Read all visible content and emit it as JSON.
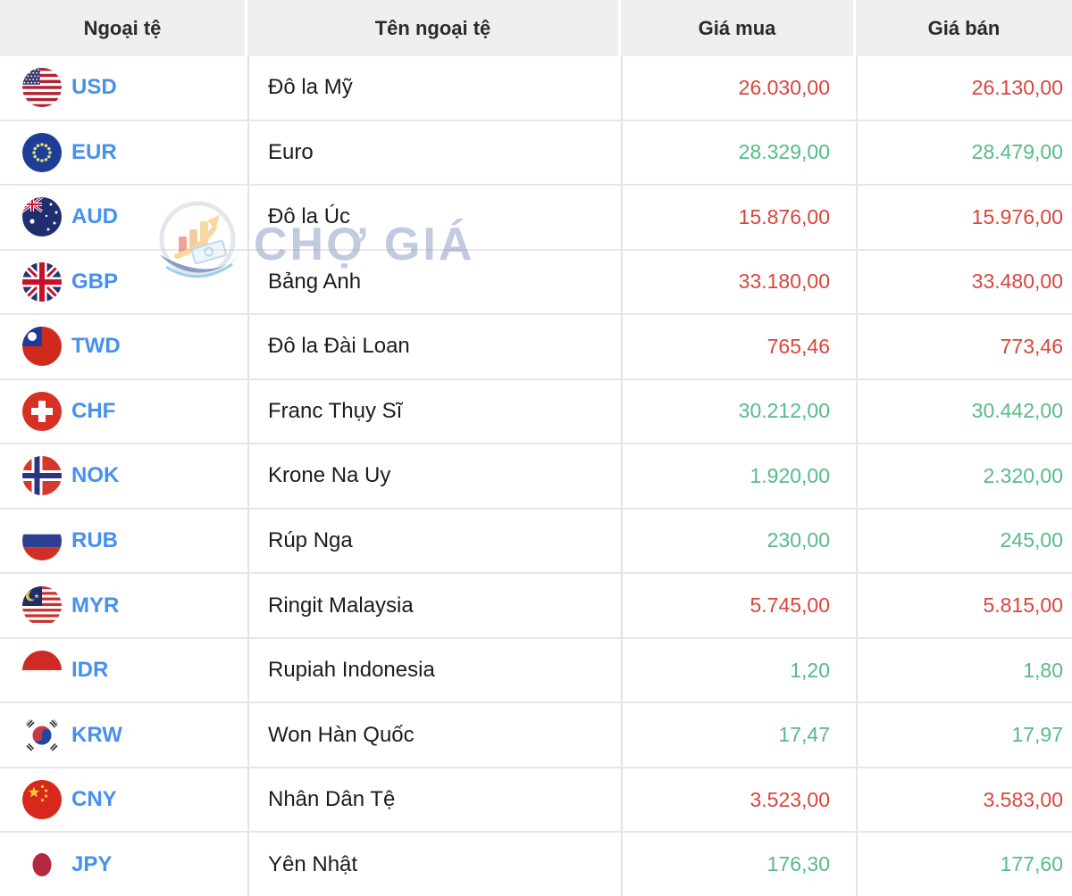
{
  "table": {
    "columns": [
      "Ngoại tệ",
      "Tên ngoại tệ",
      "Giá mua",
      "Giá bán"
    ],
    "rows": [
      {
        "code": "USD",
        "name": "Đô la Mỹ",
        "buy": "26.030,00",
        "sell": "26.130,00",
        "direction": "down"
      },
      {
        "code": "EUR",
        "name": "Euro",
        "buy": "28.329,00",
        "sell": "28.479,00",
        "direction": "up"
      },
      {
        "code": "AUD",
        "name": "Đô la Úc",
        "buy": "15.876,00",
        "sell": "15.976,00",
        "direction": "down"
      },
      {
        "code": "GBP",
        "name": "Bảng Anh",
        "buy": "33.180,00",
        "sell": "33.480,00",
        "direction": "down"
      },
      {
        "code": "TWD",
        "name": "Đô la Đài Loan",
        "buy": "765,46",
        "sell": "773,46",
        "direction": "down"
      },
      {
        "code": "CHF",
        "name": "Franc Thụy Sĩ",
        "buy": "30.212,00",
        "sell": "30.442,00",
        "direction": "up"
      },
      {
        "code": "NOK",
        "name": "Krone Na Uy",
        "buy": "1.920,00",
        "sell": "2.320,00",
        "direction": "up"
      },
      {
        "code": "RUB",
        "name": "Rúp Nga",
        "buy": "230,00",
        "sell": "245,00",
        "direction": "up"
      },
      {
        "code": "MYR",
        "name": "Ringit Malaysia",
        "buy": "5.745,00",
        "sell": "5.815,00",
        "direction": "down"
      },
      {
        "code": "IDR",
        "name": "Rupiah Indonesia",
        "buy": "1,20",
        "sell": "1,80",
        "direction": "up"
      },
      {
        "code": "KRW",
        "name": "Won Hàn Quốc",
        "buy": "17,47",
        "sell": "17,97",
        "direction": "up"
      },
      {
        "code": "CNY",
        "name": "Nhân Dân Tệ",
        "buy": "3.523,00",
        "sell": "3.583,00",
        "direction": "down"
      },
      {
        "code": "JPY",
        "name": "Yên Nhật",
        "buy": "176,30",
        "sell": "177,60",
        "direction": "up"
      }
    ]
  },
  "watermark": {
    "text": "CHỢ GIÁ"
  },
  "colors": {
    "price_up": "#57ba88",
    "price_down": "#d9453c",
    "currency_code": "#4690ee",
    "header_bg": "#efefef"
  }
}
